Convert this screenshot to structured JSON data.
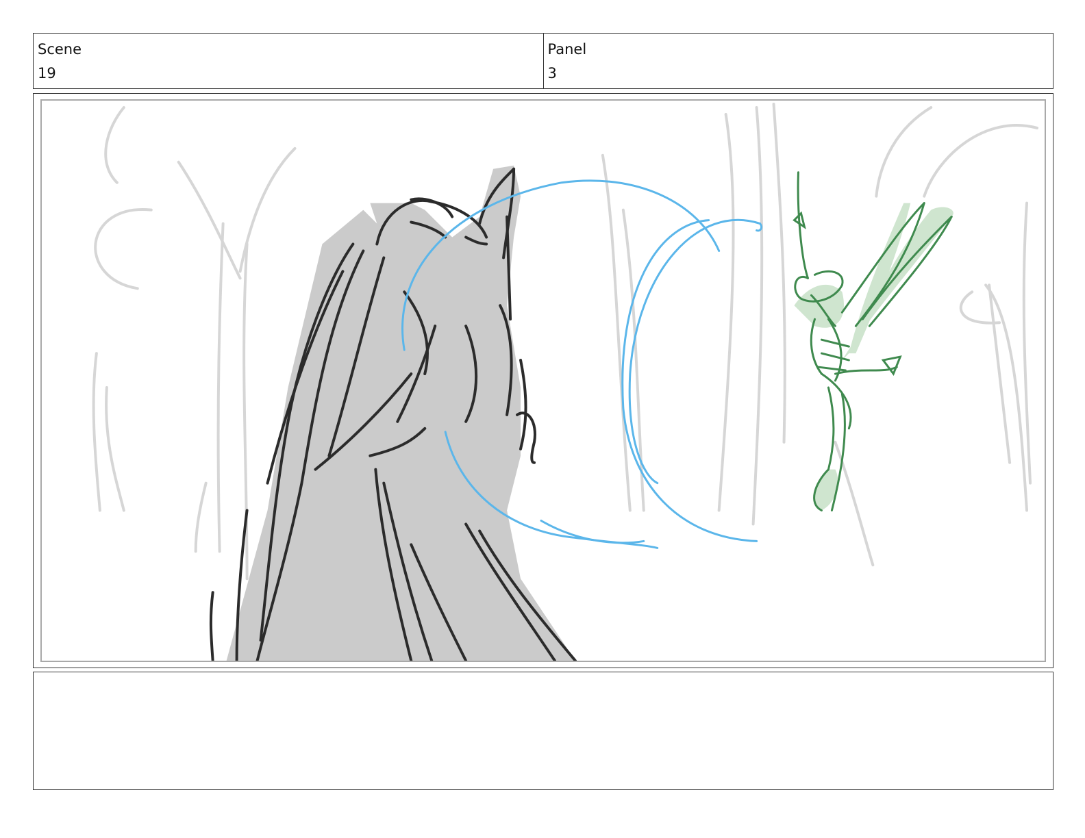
{
  "header": {
    "scene": {
      "label": "Scene",
      "value": "19"
    },
    "panel": {
      "label": "Panel",
      "value": "3"
    }
  },
  "artwork": {
    "description_icon": "storyboard-sketch",
    "colors": {
      "background_lines": "#d6d6d6",
      "bird_fill": "#cbcbcb",
      "bird_line": "#2b2b2b",
      "magic_arc": "#5bb6ea",
      "fairy_line": "#3f8a4e",
      "fairy_fill": "#cfe5cf"
    }
  },
  "notes": {
    "text": ""
  }
}
